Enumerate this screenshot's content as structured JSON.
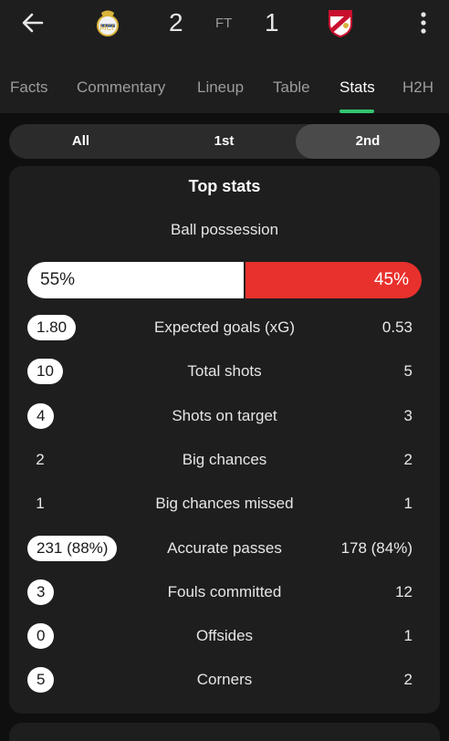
{
  "match": {
    "home_score": "2",
    "status": "FT",
    "away_score": "1",
    "home_crest_icon": "real-madrid-crest-icon",
    "away_crest_icon": "rayo-vallecano-crest-icon"
  },
  "tabs": [
    {
      "label": "Facts"
    },
    {
      "label": "Commentary"
    },
    {
      "label": "Lineup"
    },
    {
      "label": "Table"
    },
    {
      "label": "Stats"
    },
    {
      "label": "H2H"
    }
  ],
  "active_tab": "Stats",
  "periods": [
    {
      "label": "All"
    },
    {
      "label": "1st"
    },
    {
      "label": "2nd"
    }
  ],
  "selected_period": "2nd",
  "top_stats": {
    "title": "Top stats",
    "possession": {
      "label": "Ball possession",
      "home": "55%",
      "away": "45%",
      "home_fraction": 0.55,
      "home_color": "#ffffff",
      "away_color": "#e8302c"
    },
    "rows": [
      {
        "home": "1.80",
        "label": "Expected goals (xG)",
        "away": "0.53",
        "home_highlight": true
      },
      {
        "home": "10",
        "label": "Total shots",
        "away": "5",
        "home_highlight": true
      },
      {
        "home": "4",
        "label": "Shots on target",
        "away": "3",
        "home_highlight": true
      },
      {
        "home": "2",
        "label": "Big chances",
        "away": "2",
        "home_highlight": false
      },
      {
        "home": "1",
        "label": "Big chances missed",
        "away": "1",
        "home_highlight": false
      },
      {
        "home": "231 (88%)",
        "label": "Accurate passes",
        "away": "178 (84%)",
        "home_highlight": true
      },
      {
        "home": "3",
        "label": "Fouls committed",
        "away": "12",
        "home_highlight": true
      },
      {
        "home": "0",
        "label": "Offsides",
        "away": "1",
        "home_highlight": true
      },
      {
        "home": "5",
        "label": "Corners",
        "away": "2",
        "home_highlight": true
      }
    ]
  },
  "colors": {
    "accent": "#35c471",
    "away": "#e8302c",
    "background": "#0f0f0f",
    "card": "#1e1e1e"
  }
}
